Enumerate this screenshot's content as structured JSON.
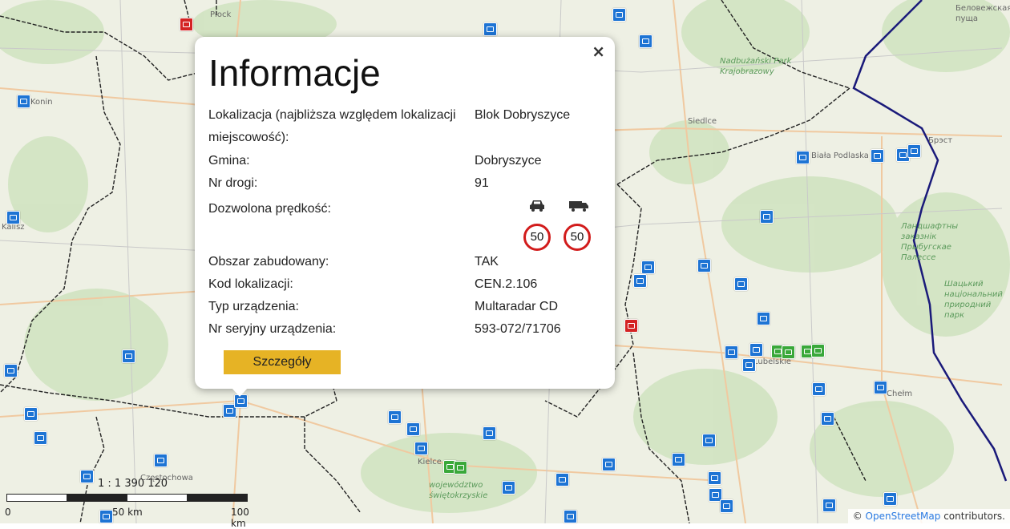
{
  "popup": {
    "title": "Informacje",
    "close": "×",
    "rows": [
      {
        "label": "Lokalizacja (najbliższa względem lokalizacji miejscowość):",
        "value": "Blok Dobryszyce"
      },
      {
        "label": "Gmina:",
        "value": "Dobryszyce"
      },
      {
        "label": "Nr drogi:",
        "value": "91"
      },
      {
        "label": "Dozwolona prędkość:",
        "value": ""
      },
      {
        "label": "Obszar zabudowany:",
        "value": "TAK"
      },
      {
        "label": "Kod lokalizacji:",
        "value": "CEN.2.106"
      },
      {
        "label": "Typ urządzenia:",
        "value": "Multaradar CD"
      },
      {
        "label": "Nr seryjny urządzenia:",
        "value": "593-072/71706"
      }
    ],
    "speed": {
      "car_icon": "car-icon",
      "truck_icon": "truck-icon",
      "car_limit": "50",
      "truck_limit": "50"
    },
    "details_button": "Szczegóły"
  },
  "map": {
    "labels": [
      {
        "text": "Płock"
      },
      {
        "text": "Konin"
      },
      {
        "text": "Kalisz"
      },
      {
        "text": "Siedlce"
      },
      {
        "text": "Biała Podlaska"
      },
      {
        "text": "Chełm"
      },
      {
        "text": "Lubelskie"
      },
      {
        "text": "Kielce"
      },
      {
        "text": "Częstochowa"
      },
      {
        "text": "województwo świętokrzyskie"
      },
      {
        "text": "Nadbużański Park Krajobrazowy"
      },
      {
        "text": "Беловежская пуща"
      },
      {
        "text": "Брэст"
      },
      {
        "text": "Шацький національний природний парк"
      },
      {
        "text": "Ландшафтны заказнік Прыбугскае Палессе"
      }
    ],
    "scale": {
      "ratio": "1 : 1 390 120",
      "tick0": "0",
      "tick1": "50 km",
      "tick2": "100 km"
    },
    "attribution": {
      "prefix": "©",
      "link": "OpenStreetMap",
      "suffix": " contributors."
    },
    "colors": {
      "camera": "#1e74d4",
      "section": "#3aa83a",
      "redlight": "#d42323",
      "border": "#1a1a7a",
      "button": "#e6b325"
    }
  }
}
